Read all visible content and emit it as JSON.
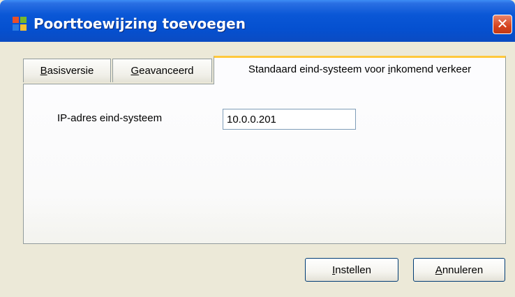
{
  "window": {
    "title": "Poorttoewijzing toevoegen",
    "close_glyph": "✕",
    "title_icon": "windows-flag-icon"
  },
  "tabs": [
    {
      "hotkey": "B",
      "rest": "asisversie",
      "active": false
    },
    {
      "hotkey": "G",
      "rest": "eavanceerd",
      "active": false
    },
    {
      "pre": "Standaard eind-systeem voor ",
      "hotkey": "i",
      "rest": "nkomend verkeer",
      "active": true
    }
  ],
  "form": {
    "ip_label": "IP-adres eind-systeem",
    "ip_value": "10.0.0.201"
  },
  "buttons": {
    "ok": {
      "hotkey": "I",
      "rest": "nstellen"
    },
    "cancel": {
      "hotkey": "A",
      "rest": "nnuleren"
    }
  }
}
